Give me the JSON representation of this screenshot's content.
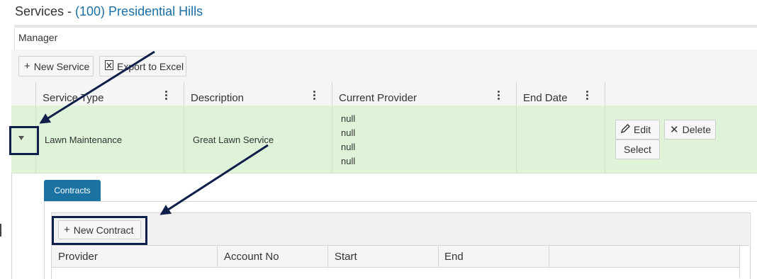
{
  "header": {
    "title_prefix": "Services - ",
    "title_link": "(100) Presidential Hills"
  },
  "tabs": {
    "active": "Manager"
  },
  "toolbar": {
    "new_service_label": "New Service",
    "export_label": "Export to Excel"
  },
  "grid": {
    "columns": [
      "Service Type",
      "Description",
      "Current Provider",
      "End Date"
    ],
    "row": {
      "service_type": "Lawn Maintenance",
      "description": "Great Lawn Service",
      "current_provider": [
        "null",
        "null",
        "null",
        "null"
      ],
      "end_date": "",
      "edit_label": "Edit",
      "delete_label": "Delete",
      "select_label": "Select"
    }
  },
  "detail": {
    "tab_label": "Contracts",
    "new_contract_label": "New Contract",
    "columns": [
      "Provider",
      "Account No",
      "Start",
      "End"
    ]
  },
  "colors": {
    "accent": "#1a73a3",
    "title_link": "#1a6fa5",
    "selected_row": "#def3d8",
    "annotation": "#0d1f4a"
  }
}
